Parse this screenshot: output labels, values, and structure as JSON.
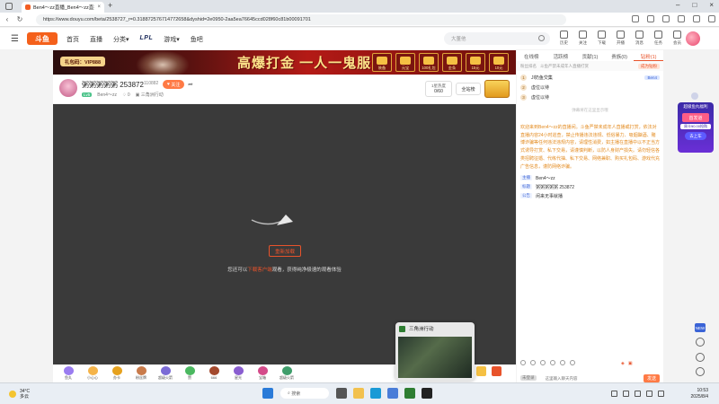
{
  "browser": {
    "tab_title": "Ben4～zz直播_Ben4～zz直播_Be...",
    "url": "https://www.douyu.com/beta/2538727_r=0.318872576714772658&dyshid=2e0950-2aa5ea76645ccd028f60c81b00091701"
  },
  "header": {
    "logo": "斗鱼",
    "nav": [
      "首页",
      "直播",
      "分类",
      "LPL",
      "游戏",
      "鱼吧"
    ],
    "search_placeholder": "大董他",
    "icons": [
      {
        "name": "history",
        "label": "历史"
      },
      {
        "name": "follow",
        "label": "关注"
      },
      {
        "name": "download",
        "label": "下载"
      },
      {
        "name": "open-stream",
        "label": "开播"
      },
      {
        "name": "message",
        "label": "消息"
      },
      {
        "name": "task",
        "label": "任务"
      },
      {
        "name": "member",
        "label": "会员"
      }
    ]
  },
  "banner": {
    "badge": "礼包码：VIP888",
    "slogan": "高爆打金 一人一鬼服",
    "prizes": [
      "装备",
      "元宝",
      "100礼包",
      "金条",
      "15元",
      "10元"
    ]
  },
  "room": {
    "title": "粥粥粥粥粥 253872",
    "id": "110882",
    "follow_label": "关注",
    "level": "Lv5",
    "anchor": "Ben4～zz",
    "popularity": "0",
    "category": "三角洲行动",
    "rank_label": "1星热度",
    "rank_value": "0/60",
    "fullsite_label": "全站榜"
  },
  "player": {
    "reload_label": "重新加载",
    "tip_prefix": "您还可以",
    "tip_link": "下载客户端",
    "tip_suffix": "观看，获得纯净极速的观看体验"
  },
  "gifts": [
    {
      "label": "鱼丸",
      "color": "#9a7cf0"
    },
    {
      "label": "小心心",
      "color": "#f5b44a"
    },
    {
      "label": "办卡",
      "color": "#e6a21f"
    },
    {
      "label": "粉丝牌",
      "color": "#c97b4b"
    },
    {
      "label": "超级火箭",
      "color": "#7b6bd6"
    },
    {
      "label": "赞",
      "color": "#4bb860"
    },
    {
      "label": "666",
      "color": "#a3492d"
    },
    {
      "label": "星光",
      "color": "#8a5ed0"
    },
    {
      "label": "宝箱",
      "color": "#d44b8a"
    },
    {
      "label": "超级火箭",
      "color": "#3f9d6b"
    }
  ],
  "mini_window": {
    "title": "三角洲行动"
  },
  "sidebar": {
    "tabs": [
      "在线榜",
      "活跃榜",
      "贡献(1)",
      "贵族(0)",
      "钻粉(1)"
    ],
    "fan_hint": "粉丝排名",
    "fan_hint2": "斗鱼严禁未成年人直播打赏",
    "fan_button": "成为钻粉",
    "ranks": [
      {
        "n": "1",
        "name": "JI奶鱼交集",
        "tag": "Ben4"
      },
      {
        "n": "2",
        "name": "虚位以待",
        "tag": ""
      },
      {
        "n": "3",
        "name": "虚位以待",
        "tag": ""
      }
    ],
    "chat_hint": "弹幕将在这里显示哦",
    "welcome": "欢迎来到Ben4～zz的直播间。斗鱼严禁未成年人直播或打赏，依法对直播内容24小时巡查，禁止传播违法违规、低俗暴力、吸烟酗酒、赌博诈骗等任何违法违规内容，请理性消费，如主播在直播中以不正当方式诱导打赏、私下交易，请谨慎判断，以防人身财产损失。请勿轻信各类招聘征婚、代练代抽、私下交易、网络兼职、购买礼包码、游戏代充广告信息，谨防网络诈骗。",
    "info": [
      {
        "k": "主播",
        "v": "Ben4～zz"
      },
      {
        "k": "标题",
        "v": "粥粥粥粥粥 253872"
      },
      {
        "k": "公告",
        "v": "闲来无事就播"
      }
    ],
    "input_level": "未登录",
    "input_placeholder": "这里输入聊天内容",
    "send_label": "发送"
  },
  "promo": {
    "title": "超级鱼丸福利",
    "badge": "首发道",
    "week": "周卡¥0.00抢购",
    "button": "去上车"
  },
  "taskbar": {
    "temp": "34°C",
    "weather": "多云",
    "search_label": "搜索",
    "time": "10:53",
    "date": "2025/8/4"
  },
  "colors": {
    "accent": "#e8532b",
    "brand": "#f4601b"
  }
}
